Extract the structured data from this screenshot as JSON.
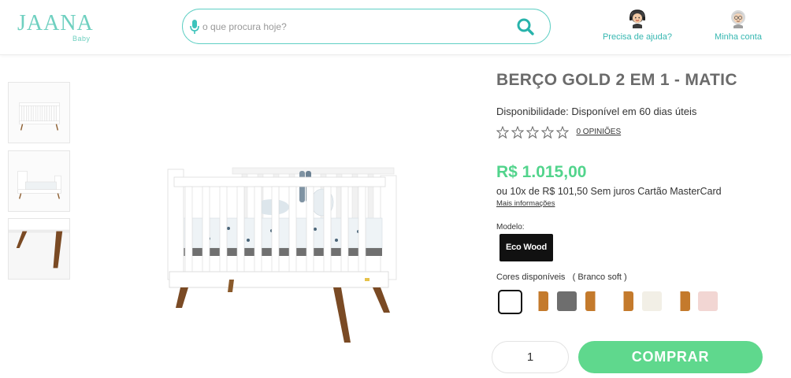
{
  "brand": {
    "name": "JAANA",
    "sub": "Baby",
    "color": "#6fd0c0"
  },
  "search": {
    "placeholder": "o que procura hoje?",
    "value": "",
    "icon": "search-icon",
    "mic_icon": "microphone-icon"
  },
  "header": {
    "help_label": "Precisa de ajuda?",
    "help_icon": "headset-avatar-icon",
    "account_label": "Minha conta",
    "account_icon": "user-avatar-icon",
    "accent": "#36b7b1"
  },
  "gallery": {
    "thumbnails": [
      "crib-thumbnail",
      "toddler-bed-thumbnail",
      "crib-leg-closeup-thumbnail"
    ],
    "main": "white-crib-with-wood-legs"
  },
  "product": {
    "title": "BERÇO GOLD 2 EM 1 - MATIC",
    "availability": "Disponibilidade: Disponível em 60 dias úteis",
    "rating": 0,
    "rating_max": 5,
    "reviews_link": "0 OPINIÕES",
    "price": "R$ 1.015,00",
    "price_color": "#52d48c",
    "installments": "ou 10x de R$ 101,50 Sem juros Cartão MasterCard",
    "more_info": "Mais informações",
    "model_label": "Modelo:",
    "model_selected": "Eco Wood",
    "colors_label": "Cores disponíveis   ( Branco soft )",
    "colors": [
      {
        "name": "Branco soft",
        "selected": true,
        "c1": "#ffffff",
        "c2": "#ffffff"
      },
      {
        "name": "swatch-2",
        "c1": "#ffffff",
        "c2": "#c47a2c"
      },
      {
        "name": "swatch-3",
        "c1": "#6e6e6e",
        "c2": "#6e6e6e"
      },
      {
        "name": "swatch-4",
        "c1": "#c47a2c",
        "c2": "#ffffff"
      },
      {
        "name": "swatch-5",
        "c1": "#ffffff",
        "c2": "#c47a2c"
      },
      {
        "name": "swatch-6",
        "c1": "#f2efe6",
        "c2": "#f2efe6"
      },
      {
        "name": "swatch-7",
        "c1": "#ffffff",
        "c2": "#c47a2c"
      },
      {
        "name": "swatch-8",
        "c1": "#f2d6d3",
        "c2": "#f2d6d3"
      }
    ]
  },
  "buy": {
    "quantity": "1",
    "button_label": "COMPRAR",
    "button_color": "#5fd88d"
  }
}
